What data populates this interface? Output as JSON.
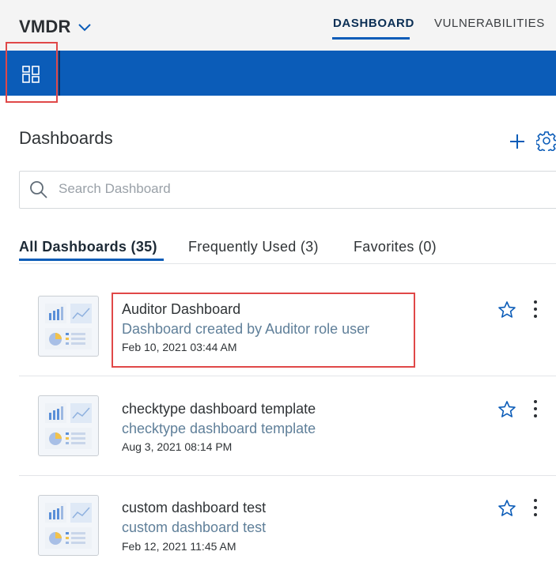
{
  "header": {
    "app_title": "VMDR",
    "tabs": [
      {
        "label": "DASHBOARD",
        "active": true
      },
      {
        "label": "VULNERABILITIES",
        "active": false
      }
    ]
  },
  "colors": {
    "brand_blue": "#0b5cb8",
    "highlight_red": "#e04848",
    "description_text": "#5f7f99"
  },
  "section": {
    "title": "Dashboards"
  },
  "search": {
    "placeholder": "Search Dashboard",
    "value": ""
  },
  "filter_tabs": [
    {
      "label": "All Dashboards (35)",
      "active": true
    },
    {
      "label": "Frequently Used (3)",
      "active": false
    },
    {
      "label": "Favorites (0)",
      "active": false
    }
  ],
  "dashboards": [
    {
      "name": "Auditor Dashboard",
      "description": "Dashboard created by Auditor role user",
      "date": "Feb 10, 2021 03:44 AM",
      "favorite": false
    },
    {
      "name": "checktype dashboard template",
      "description": "checktype dashboard template",
      "date": "Aug 3, 2021 08:14 PM",
      "favorite": false
    },
    {
      "name": "custom dashboard test",
      "description": "custom dashboard test",
      "date": "Feb 12, 2021 11:45 AM",
      "favorite": false
    }
  ],
  "icons": {
    "app_switch": "chevron-down-icon",
    "dashboard_grid": "dashboard-grid-icon",
    "add": "plus-icon",
    "settings": "gear-icon",
    "search": "search-icon",
    "favorite": "star-outline-icon",
    "more": "kebab-menu-icon"
  }
}
